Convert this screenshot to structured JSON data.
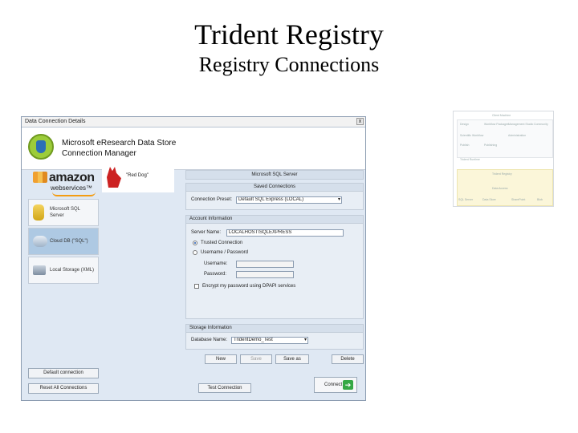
{
  "slide": {
    "title": "Trident Registry",
    "subtitle": "Registry Connections"
  },
  "window": {
    "title": "Data Connection Details",
    "close_symbol": "x",
    "header_line1": "Microsoft eResearch Data Store",
    "header_line2": "Connection Manager"
  },
  "sidebar": {
    "aws_word": "amazon",
    "aws_sub": "webservices™",
    "items": [
      {
        "label1": "Microsoft SQL",
        "label2": "Server"
      },
      {
        "label1": "Cloud DB (\"SQL\")",
        "label2": ""
      },
      {
        "label1": "Local Storage (XML)",
        "label2": ""
      }
    ],
    "default_connection": "Default connection",
    "reset_all": "Reset All Connections"
  },
  "red_dog": {
    "label": "\"Red Dog\""
  },
  "main": {
    "panel_title": "Microsoft SQL Server",
    "saved": {
      "head": "Saved Connections",
      "preset_label": "Connection Preset:",
      "preset_value": "Default SQL Express (LOCAL)"
    },
    "account": {
      "head": "Account Information",
      "server_label": "Server Name:",
      "server_value": "LOCALHOST\\SQLEXPRESS",
      "trusted": "Trusted Connection",
      "username_password": "Username / Password",
      "username_label": "Username:",
      "password_label": "Password:",
      "encrypt": "Encrypt my password using DPAPI services"
    },
    "storage": {
      "head": "Storage Information",
      "db_label": "Database Name:",
      "db_value": "TridentDemo_Test"
    },
    "buttons": {
      "new": "New",
      "save": "Save",
      "save_as": "Save as",
      "delete": "Delete"
    },
    "test_connection": "Test Connection",
    "connect": "Connect",
    "connect_arrow": "➔"
  },
  "thumbnail": {
    "title": "Client Machine",
    "registry": "Trident Registry",
    "labels": [
      "Design",
      "Workflow Packages",
      "Management Studio",
      "Community",
      "Scientific Workflow",
      "Administration",
      "Publish",
      "Publishing",
      "Trident Runtime",
      "Data Access",
      "SQL Server",
      "Data Store",
      "SharePoint",
      "Blob"
    ]
  }
}
